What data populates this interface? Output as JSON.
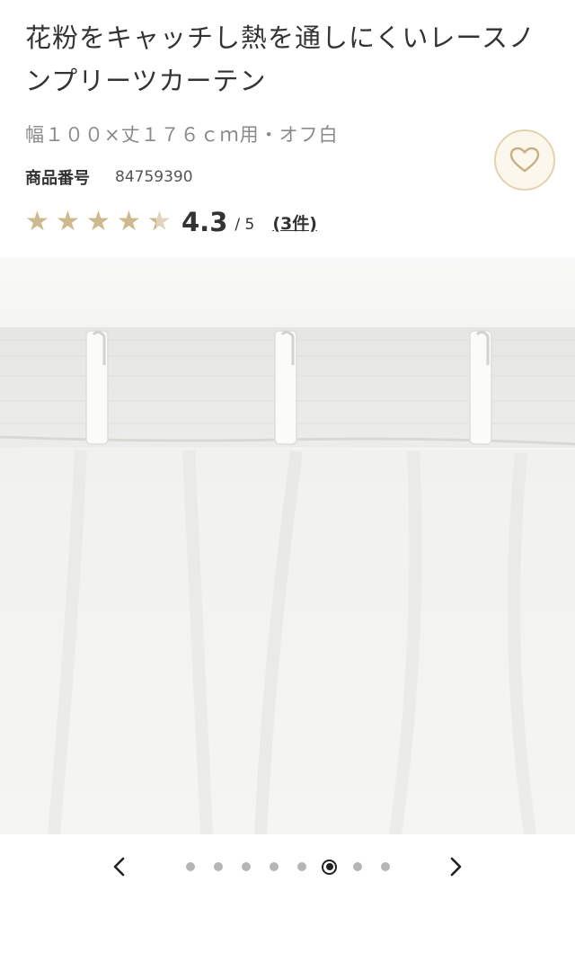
{
  "product": {
    "title_line1": "花粉をキャッチし熱を通しにくいレースノ",
    "title_line2": "ンプリーツカーテン",
    "variant": "幅１００×丈１７６ｃｍ用・オフ白",
    "code_label": "商品番号",
    "code_value": "84759390"
  },
  "rating": {
    "value": "4.3",
    "max": "/ 5",
    "reviews": "(3件)",
    "score": 4.3,
    "star_count": 5
  },
  "favorite": {
    "icon": "heart-icon"
  },
  "gallery": {
    "image_description_icon": "curtain-photo",
    "total_slides": 8,
    "active_index": 5,
    "prev_icon": "chevron-left-icon",
    "next_icon": "chevron-right-icon"
  },
  "colors": {
    "star_filled": "#cdb98d",
    "star_empty": "#e1d6bd",
    "favorite_border": "#e2d2ae",
    "favorite_bg": "#fbf7ec"
  }
}
